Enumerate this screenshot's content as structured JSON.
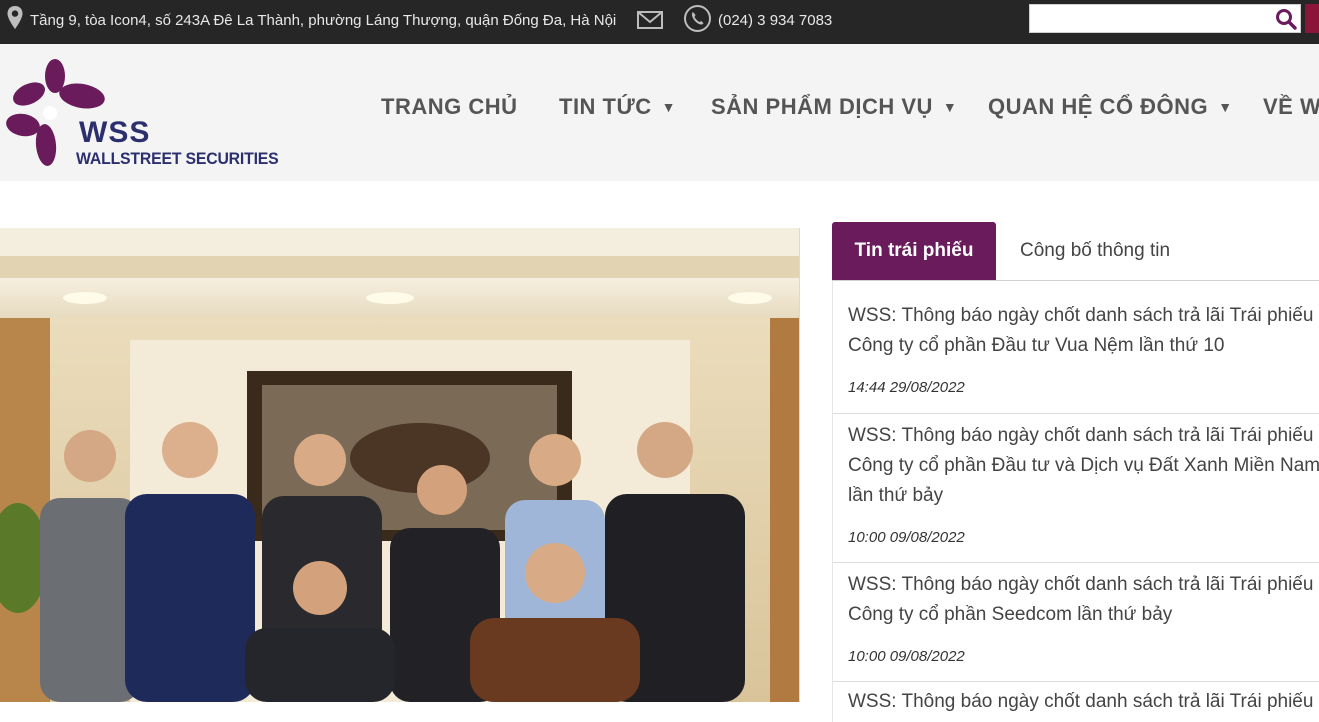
{
  "topbar": {
    "address": "Tầng 9, tòa Icon4, số 243A Đê La Thành, phường Láng Thượng, quận Đống Đa, Hà Nội",
    "phone": "(024) 3 934 7083",
    "search_placeholder": ""
  },
  "logo": {
    "name": "WSS",
    "subtitle": "WALLSTREET SECURITIES"
  },
  "nav": {
    "items": [
      {
        "label": "TRANG CHỦ",
        "has_dropdown": false
      },
      {
        "label": "TIN TỨC",
        "has_dropdown": true
      },
      {
        "label": "SẢN PHẨM DỊCH VỤ",
        "has_dropdown": true
      },
      {
        "label": "QUAN HỆ CỔ ĐÔNG",
        "has_dropdown": true
      },
      {
        "label": "VỀ W",
        "has_dropdown": false
      }
    ]
  },
  "news": {
    "tabs": [
      {
        "label": "Tin trái phiếu",
        "active": true
      },
      {
        "label": "Công bố thông tin",
        "active": false
      }
    ],
    "items": [
      {
        "title_lines": [
          "WSS: Thông báo ngày chốt danh sách trả lãi Trái phiếu",
          "Công ty cổ phần Đầu tư Vua Nệm lần thứ 10"
        ],
        "time": "14:44 29/08/2022"
      },
      {
        "title_lines": [
          "WSS: Thông báo ngày chốt danh sách trả lãi Trái phiếu",
          "Công ty cổ phần Đầu tư và Dịch vụ Đất Xanh Miền Nam",
          "lần thứ bảy"
        ],
        "time": "10:00 09/08/2022"
      },
      {
        "title_lines": [
          "WSS: Thông báo ngày chốt danh sách trả lãi Trái phiếu",
          "Công ty cổ phần Seedcom lần thứ bảy"
        ],
        "time": "10:00 09/08/2022"
      },
      {
        "title_lines": [
          "WSS: Thông báo ngày chốt danh sách trả lãi Trái phiếu"
        ],
        "time": ""
      }
    ]
  },
  "colors": {
    "topbar_bg": "#262626",
    "header_bg": "#f4f4f4",
    "brand_purple": "#6a1b5c",
    "logo_navy": "#2b2f6e",
    "accent_red": "#8b1538"
  },
  "icons": {
    "address": "map-pin-icon",
    "email": "envelope-icon",
    "phone": "phone-icon",
    "search": "search-icon",
    "dropdown": "caret-down-icon"
  }
}
